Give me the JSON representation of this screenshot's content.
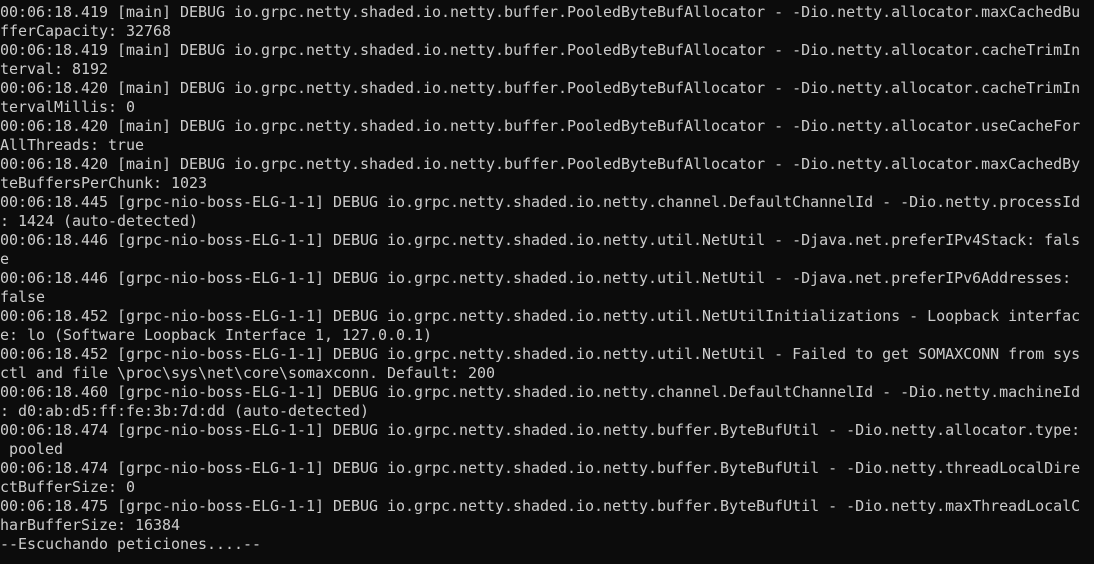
{
  "terminal": {
    "lines": [
      "00:06:18.419 [main] DEBUG io.grpc.netty.shaded.io.netty.buffer.PooledByteBufAllocator - -Dio.netty.allocator.maxCachedBu",
      "fferCapacity: 32768",
      "00:06:18.419 [main] DEBUG io.grpc.netty.shaded.io.netty.buffer.PooledByteBufAllocator - -Dio.netty.allocator.cacheTrimIn",
      "terval: 8192",
      "00:06:18.420 [main] DEBUG io.grpc.netty.shaded.io.netty.buffer.PooledByteBufAllocator - -Dio.netty.allocator.cacheTrimIn",
      "tervalMillis: 0",
      "00:06:18.420 [main] DEBUG io.grpc.netty.shaded.io.netty.buffer.PooledByteBufAllocator - -Dio.netty.allocator.useCacheFor",
      "AllThreads: true",
      "00:06:18.420 [main] DEBUG io.grpc.netty.shaded.io.netty.buffer.PooledByteBufAllocator - -Dio.netty.allocator.maxCachedBy",
      "teBuffersPerChunk: 1023",
      "00:06:18.445 [grpc-nio-boss-ELG-1-1] DEBUG io.grpc.netty.shaded.io.netty.channel.DefaultChannelId - -Dio.netty.processId",
      ": 1424 (auto-detected)",
      "00:06:18.446 [grpc-nio-boss-ELG-1-1] DEBUG io.grpc.netty.shaded.io.netty.util.NetUtil - -Djava.net.preferIPv4Stack: fals",
      "e",
      "00:06:18.446 [grpc-nio-boss-ELG-1-1] DEBUG io.grpc.netty.shaded.io.netty.util.NetUtil - -Djava.net.preferIPv6Addresses:",
      "false",
      "00:06:18.452 [grpc-nio-boss-ELG-1-1] DEBUG io.grpc.netty.shaded.io.netty.util.NetUtilInitializations - Loopback interfac",
      "e: lo (Software Loopback Interface 1, 127.0.0.1)",
      "00:06:18.452 [grpc-nio-boss-ELG-1-1] DEBUG io.grpc.netty.shaded.io.netty.util.NetUtil - Failed to get SOMAXCONN from sys",
      "ctl and file \\proc\\sys\\net\\core\\somaxconn. Default: 200",
      "00:06:18.460 [grpc-nio-boss-ELG-1-1] DEBUG io.grpc.netty.shaded.io.netty.channel.DefaultChannelId - -Dio.netty.machineId",
      ": d0:ab:d5:ff:fe:3b:7d:dd (auto-detected)",
      "00:06:18.474 [grpc-nio-boss-ELG-1-1] DEBUG io.grpc.netty.shaded.io.netty.buffer.ByteBufUtil - -Dio.netty.allocator.type:",
      " pooled",
      "00:06:18.474 [grpc-nio-boss-ELG-1-1] DEBUG io.grpc.netty.shaded.io.netty.buffer.ByteBufUtil - -Dio.netty.threadLocalDire",
      "ctBufferSize: 0",
      "00:06:18.475 [grpc-nio-boss-ELG-1-1] DEBUG io.grpc.netty.shaded.io.netty.buffer.ByteBufUtil - -Dio.netty.maxThreadLocalC",
      "harBufferSize: 16384",
      "--Escuchando peticiones....--"
    ]
  }
}
